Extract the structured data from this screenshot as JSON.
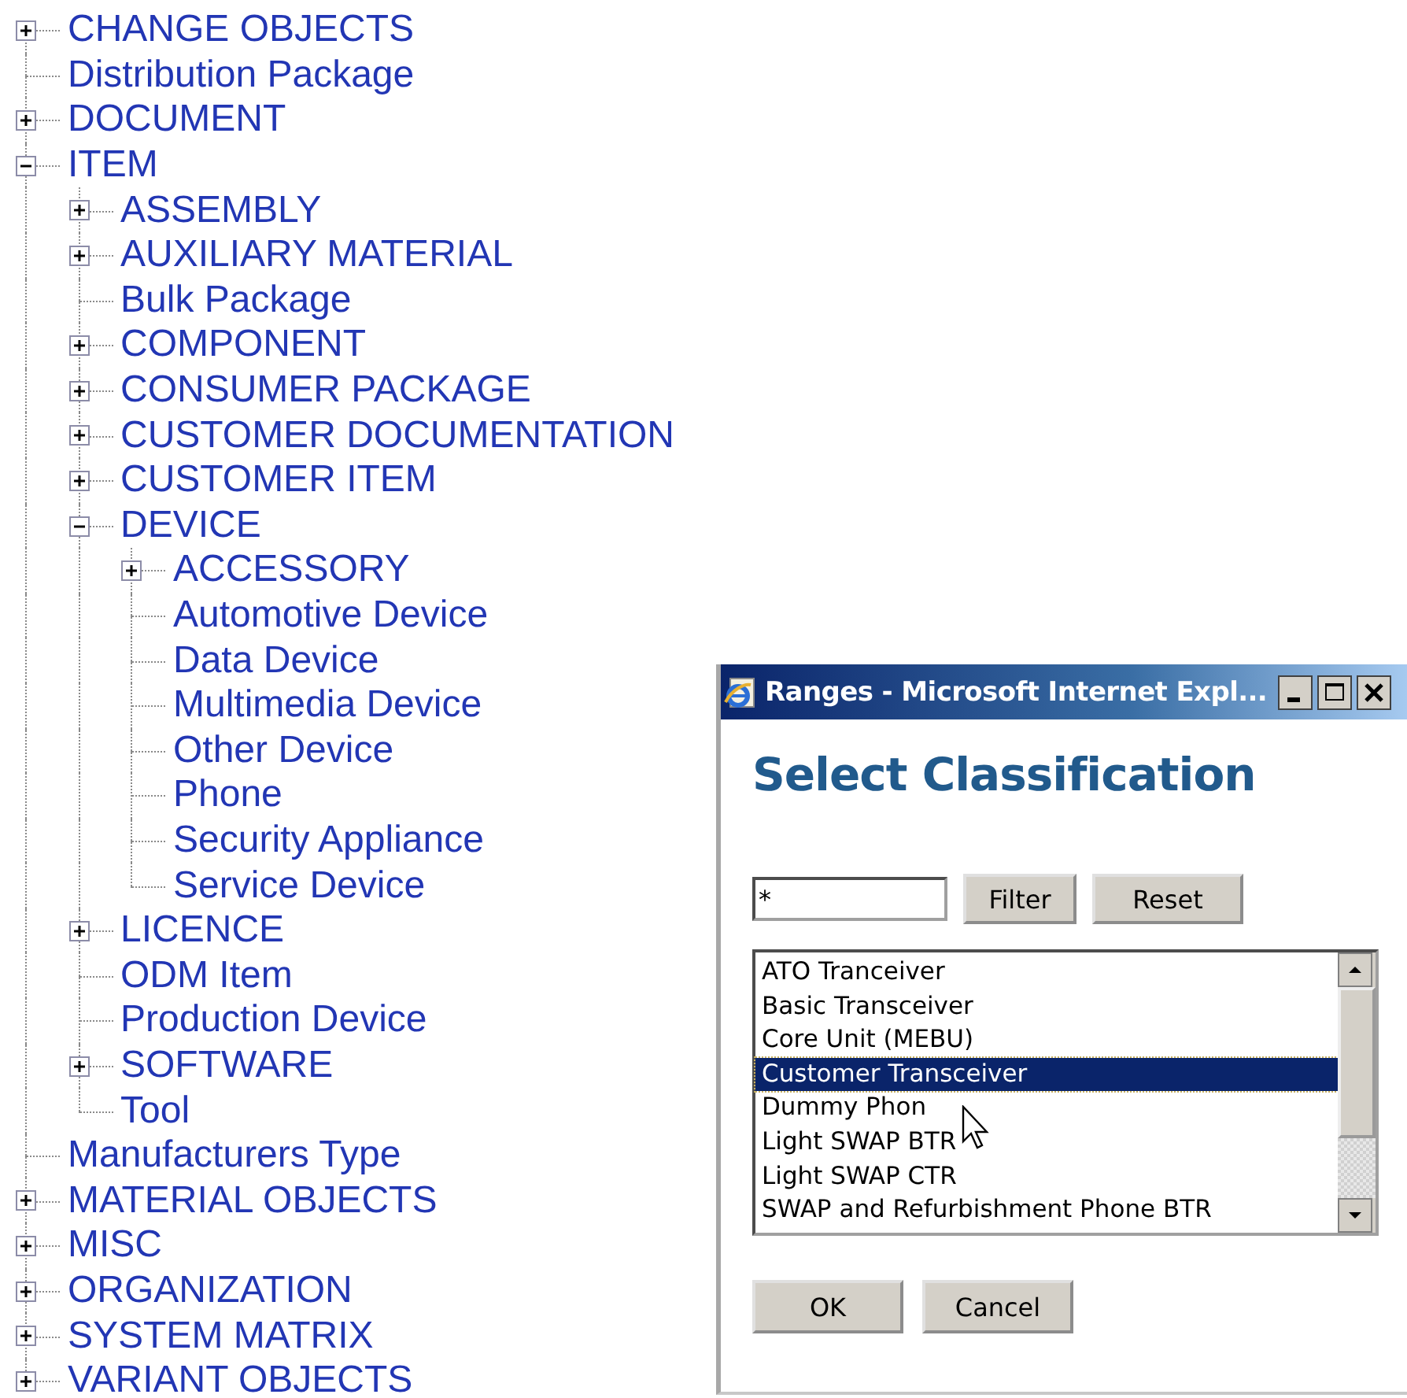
{
  "tree": [
    {
      "label": "CHANGE OBJECTS",
      "expanded": false
    },
    {
      "label": "Distribution Package"
    },
    {
      "label": "DOCUMENT",
      "expanded": false
    },
    {
      "label": "ITEM",
      "expanded": true,
      "children": [
        {
          "label": "ASSEMBLY",
          "expanded": false
        },
        {
          "label": "AUXILIARY MATERIAL",
          "expanded": false
        },
        {
          "label": "Bulk Package"
        },
        {
          "label": "COMPONENT",
          "expanded": false
        },
        {
          "label": "CONSUMER PACKAGE",
          "expanded": false
        },
        {
          "label": "CUSTOMER DOCUMENTATION",
          "expanded": false
        },
        {
          "label": "CUSTOMER ITEM",
          "expanded": false
        },
        {
          "label": "DEVICE",
          "expanded": true,
          "children": [
            {
              "label": "ACCESSORY",
              "expanded": false
            },
            {
              "label": "Automotive Device"
            },
            {
              "label": "Data Device"
            },
            {
              "label": "Multimedia Device"
            },
            {
              "label": "Other Device"
            },
            {
              "label": "Phone"
            },
            {
              "label": "Security Appliance"
            },
            {
              "label": "Service Device"
            }
          ]
        },
        {
          "label": "LICENCE",
          "expanded": false
        },
        {
          "label": "ODM Item"
        },
        {
          "label": "Production Device"
        },
        {
          "label": "SOFTWARE",
          "expanded": false
        },
        {
          "label": "Tool"
        }
      ]
    },
    {
      "label": "Manufacturers Type"
    },
    {
      "label": "MATERIAL OBJECTS",
      "expanded": false
    },
    {
      "label": "MISC",
      "expanded": false
    },
    {
      "label": "ORGANIZATION",
      "expanded": false
    },
    {
      "label": "SYSTEM MATRIX",
      "expanded": false
    },
    {
      "label": "VARIANT OBJECTS",
      "expanded": false
    }
  ],
  "dialog": {
    "title": "Ranges - Microsoft Internet Expl...",
    "heading": "Select Classification",
    "filter": {
      "value": "*"
    },
    "filter_buttons": [
      "Filter",
      "Reset"
    ],
    "list": [
      {
        "label": "ATO Tranceiver",
        "selected": false
      },
      {
        "label": "Basic Transceiver",
        "selected": false
      },
      {
        "label": "Core Unit (MEBU)",
        "selected": false
      },
      {
        "label": "Customer Transceiver",
        "selected": true
      },
      {
        "label": "Dummy Phon",
        "selected": false
      },
      {
        "label": "Light SWAP BTR",
        "selected": false
      },
      {
        "label": "Light SWAP CTR",
        "selected": false
      },
      {
        "label": "SWAP and Refurbishment Phone BTR",
        "selected": false
      }
    ],
    "buttons": [
      "OK",
      "Cancel"
    ]
  }
}
